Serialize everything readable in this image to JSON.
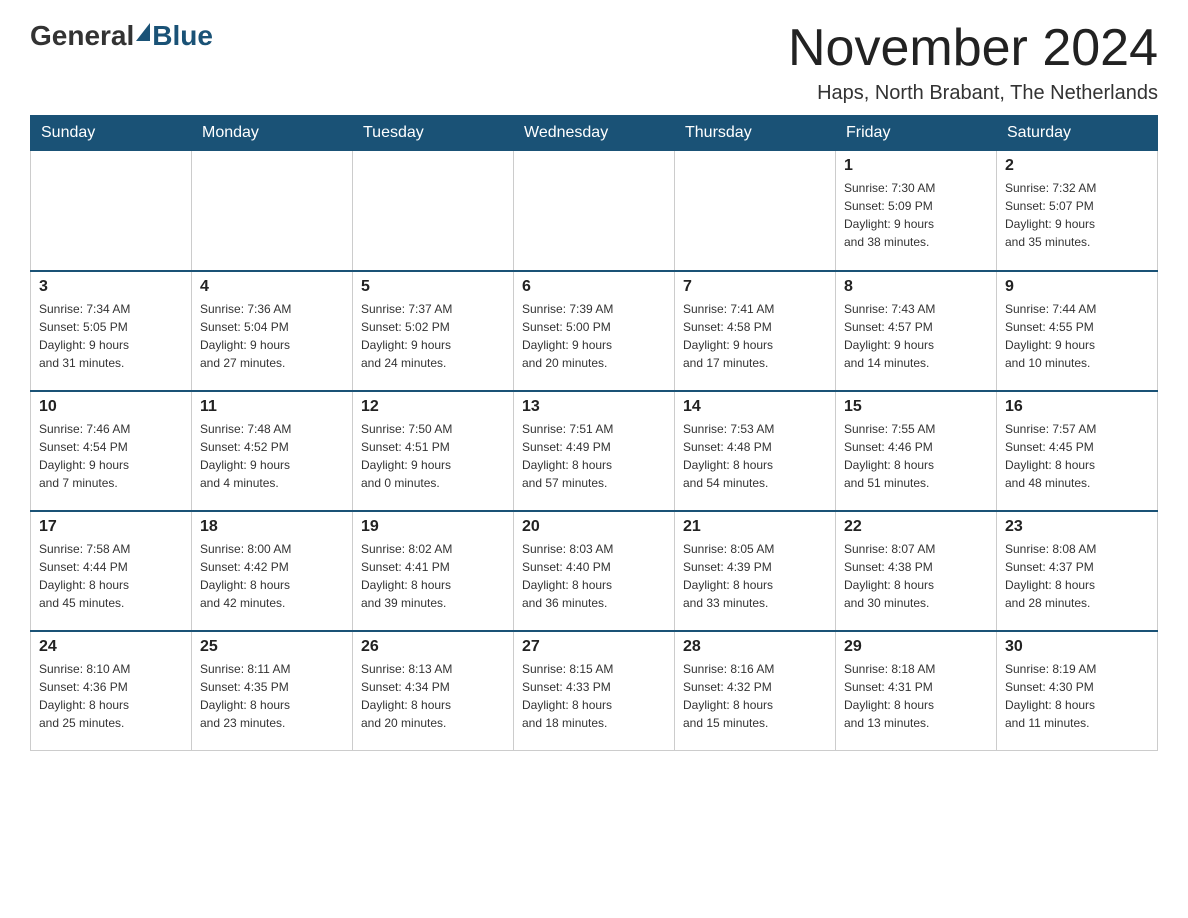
{
  "logo": {
    "text_general": "General",
    "text_blue": "Blue"
  },
  "header": {
    "month_year": "November 2024",
    "location": "Haps, North Brabant, The Netherlands"
  },
  "weekdays": [
    "Sunday",
    "Monday",
    "Tuesday",
    "Wednesday",
    "Thursday",
    "Friday",
    "Saturday"
  ],
  "weeks": [
    {
      "days": [
        {
          "num": "",
          "info": ""
        },
        {
          "num": "",
          "info": ""
        },
        {
          "num": "",
          "info": ""
        },
        {
          "num": "",
          "info": ""
        },
        {
          "num": "",
          "info": ""
        },
        {
          "num": "1",
          "info": "Sunrise: 7:30 AM\nSunset: 5:09 PM\nDaylight: 9 hours\nand 38 minutes."
        },
        {
          "num": "2",
          "info": "Sunrise: 7:32 AM\nSunset: 5:07 PM\nDaylight: 9 hours\nand 35 minutes."
        }
      ]
    },
    {
      "days": [
        {
          "num": "3",
          "info": "Sunrise: 7:34 AM\nSunset: 5:05 PM\nDaylight: 9 hours\nand 31 minutes."
        },
        {
          "num": "4",
          "info": "Sunrise: 7:36 AM\nSunset: 5:04 PM\nDaylight: 9 hours\nand 27 minutes."
        },
        {
          "num": "5",
          "info": "Sunrise: 7:37 AM\nSunset: 5:02 PM\nDaylight: 9 hours\nand 24 minutes."
        },
        {
          "num": "6",
          "info": "Sunrise: 7:39 AM\nSunset: 5:00 PM\nDaylight: 9 hours\nand 20 minutes."
        },
        {
          "num": "7",
          "info": "Sunrise: 7:41 AM\nSunset: 4:58 PM\nDaylight: 9 hours\nand 17 minutes."
        },
        {
          "num": "8",
          "info": "Sunrise: 7:43 AM\nSunset: 4:57 PM\nDaylight: 9 hours\nand 14 minutes."
        },
        {
          "num": "9",
          "info": "Sunrise: 7:44 AM\nSunset: 4:55 PM\nDaylight: 9 hours\nand 10 minutes."
        }
      ]
    },
    {
      "days": [
        {
          "num": "10",
          "info": "Sunrise: 7:46 AM\nSunset: 4:54 PM\nDaylight: 9 hours\nand 7 minutes."
        },
        {
          "num": "11",
          "info": "Sunrise: 7:48 AM\nSunset: 4:52 PM\nDaylight: 9 hours\nand 4 minutes."
        },
        {
          "num": "12",
          "info": "Sunrise: 7:50 AM\nSunset: 4:51 PM\nDaylight: 9 hours\nand 0 minutes."
        },
        {
          "num": "13",
          "info": "Sunrise: 7:51 AM\nSunset: 4:49 PM\nDaylight: 8 hours\nand 57 minutes."
        },
        {
          "num": "14",
          "info": "Sunrise: 7:53 AM\nSunset: 4:48 PM\nDaylight: 8 hours\nand 54 minutes."
        },
        {
          "num": "15",
          "info": "Sunrise: 7:55 AM\nSunset: 4:46 PM\nDaylight: 8 hours\nand 51 minutes."
        },
        {
          "num": "16",
          "info": "Sunrise: 7:57 AM\nSunset: 4:45 PM\nDaylight: 8 hours\nand 48 minutes."
        }
      ]
    },
    {
      "days": [
        {
          "num": "17",
          "info": "Sunrise: 7:58 AM\nSunset: 4:44 PM\nDaylight: 8 hours\nand 45 minutes."
        },
        {
          "num": "18",
          "info": "Sunrise: 8:00 AM\nSunset: 4:42 PM\nDaylight: 8 hours\nand 42 minutes."
        },
        {
          "num": "19",
          "info": "Sunrise: 8:02 AM\nSunset: 4:41 PM\nDaylight: 8 hours\nand 39 minutes."
        },
        {
          "num": "20",
          "info": "Sunrise: 8:03 AM\nSunset: 4:40 PM\nDaylight: 8 hours\nand 36 minutes."
        },
        {
          "num": "21",
          "info": "Sunrise: 8:05 AM\nSunset: 4:39 PM\nDaylight: 8 hours\nand 33 minutes."
        },
        {
          "num": "22",
          "info": "Sunrise: 8:07 AM\nSunset: 4:38 PM\nDaylight: 8 hours\nand 30 minutes."
        },
        {
          "num": "23",
          "info": "Sunrise: 8:08 AM\nSunset: 4:37 PM\nDaylight: 8 hours\nand 28 minutes."
        }
      ]
    },
    {
      "days": [
        {
          "num": "24",
          "info": "Sunrise: 8:10 AM\nSunset: 4:36 PM\nDaylight: 8 hours\nand 25 minutes."
        },
        {
          "num": "25",
          "info": "Sunrise: 8:11 AM\nSunset: 4:35 PM\nDaylight: 8 hours\nand 23 minutes."
        },
        {
          "num": "26",
          "info": "Sunrise: 8:13 AM\nSunset: 4:34 PM\nDaylight: 8 hours\nand 20 minutes."
        },
        {
          "num": "27",
          "info": "Sunrise: 8:15 AM\nSunset: 4:33 PM\nDaylight: 8 hours\nand 18 minutes."
        },
        {
          "num": "28",
          "info": "Sunrise: 8:16 AM\nSunset: 4:32 PM\nDaylight: 8 hours\nand 15 minutes."
        },
        {
          "num": "29",
          "info": "Sunrise: 8:18 AM\nSunset: 4:31 PM\nDaylight: 8 hours\nand 13 minutes."
        },
        {
          "num": "30",
          "info": "Sunrise: 8:19 AM\nSunset: 4:30 PM\nDaylight: 8 hours\nand 11 minutes."
        }
      ]
    }
  ]
}
